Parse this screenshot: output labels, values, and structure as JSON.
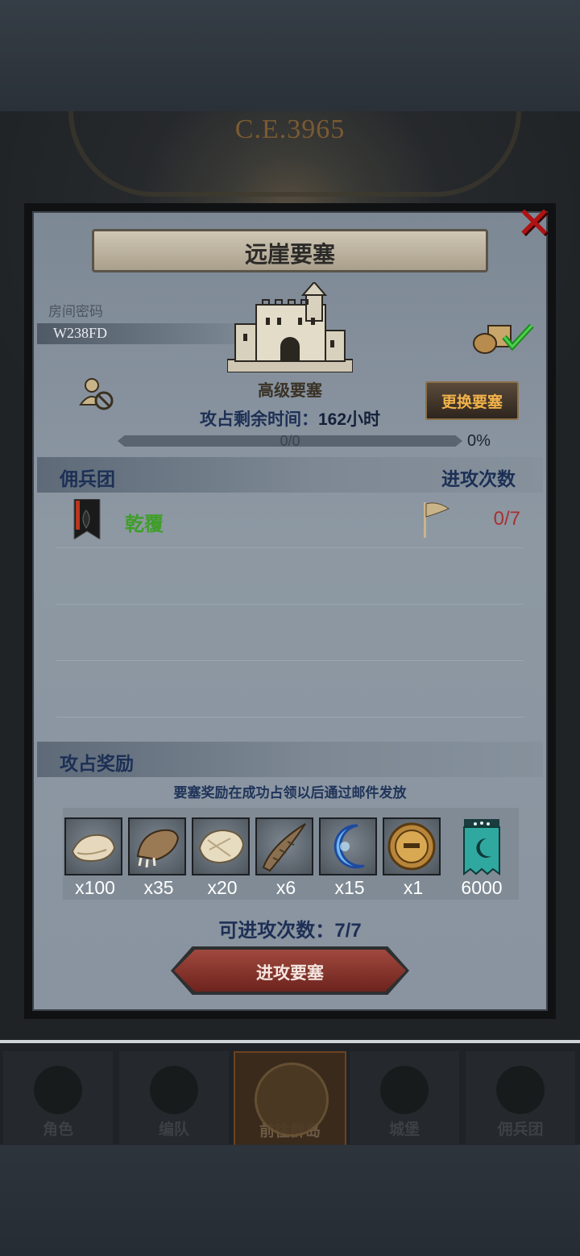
{
  "background": {
    "era_label": "C.E.3965"
  },
  "dialog": {
    "title": "远崖要塞",
    "room": {
      "label": "房间密码",
      "code": "W238FD"
    },
    "fortress": {
      "level": "高级要塞",
      "remaining_label": "攻占剩余时间：",
      "remaining_value": "162小时"
    },
    "change_button": "更换要塞",
    "progress": {
      "text": "0/0",
      "percent_label": "0%",
      "fraction": 0
    },
    "mercenary_section": {
      "title": "佣兵团",
      "attacks_header": "进攻次数"
    },
    "mercenaries": [
      {
        "name": "乾覆",
        "attacks": "0/7"
      }
    ],
    "reward_section": {
      "title": "攻占奖励",
      "note": "要塞奖励在成功占领以后通过邮件发放"
    },
    "rewards": [
      {
        "icon": "fur-pelt-icon",
        "qty": "x100"
      },
      {
        "icon": "beast-claw-icon",
        "qty": "x35"
      },
      {
        "icon": "hide-icon",
        "qty": "x20"
      },
      {
        "icon": "horn-icon",
        "qty": "x6"
      },
      {
        "icon": "blue-crescent-icon",
        "qty": "x15"
      },
      {
        "icon": "golden-helmet-icon",
        "qty": "x1"
      },
      {
        "icon": "guild-banner-icon",
        "qty": "6000"
      }
    ],
    "attempts": {
      "label": "可进攻次数：",
      "value": "7/7"
    },
    "attack_button": "进攻要塞"
  },
  "nav": {
    "items": [
      "角色",
      "编队",
      "前往群岛",
      "城堡",
      "佣兵团"
    ],
    "active_index": 2
  },
  "colors": {
    "accent_gold": "#f2b24a",
    "merc_green": "#3f9e28",
    "count_red": "#a83030",
    "close_red": "#b01212"
  }
}
